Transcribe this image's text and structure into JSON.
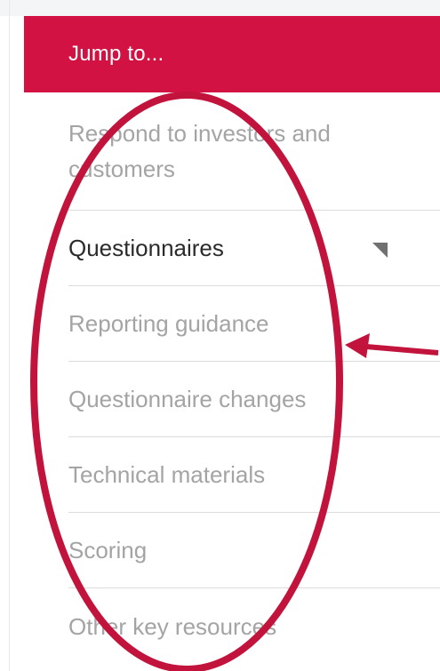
{
  "menu": {
    "header_label": "Jump to...",
    "items": [
      {
        "label": "Respond to investors and customers",
        "active": false
      },
      {
        "label": "Questionnaires",
        "active": true,
        "has_caret": true
      },
      {
        "label": "Reporting guidance",
        "active": false
      },
      {
        "label": "Questionnaire changes",
        "active": false
      },
      {
        "label": "Technical materials",
        "active": false
      },
      {
        "label": "Scoring",
        "active": false
      },
      {
        "label": "Other key resources",
        "active": false
      }
    ]
  },
  "icons": {
    "caret": "caret-down-icon"
  },
  "colors": {
    "header_bg": "#d21242",
    "annotation": "#c1133b",
    "active_text": "#2b2b2b",
    "inactive_text": "#a4a4a4"
  }
}
